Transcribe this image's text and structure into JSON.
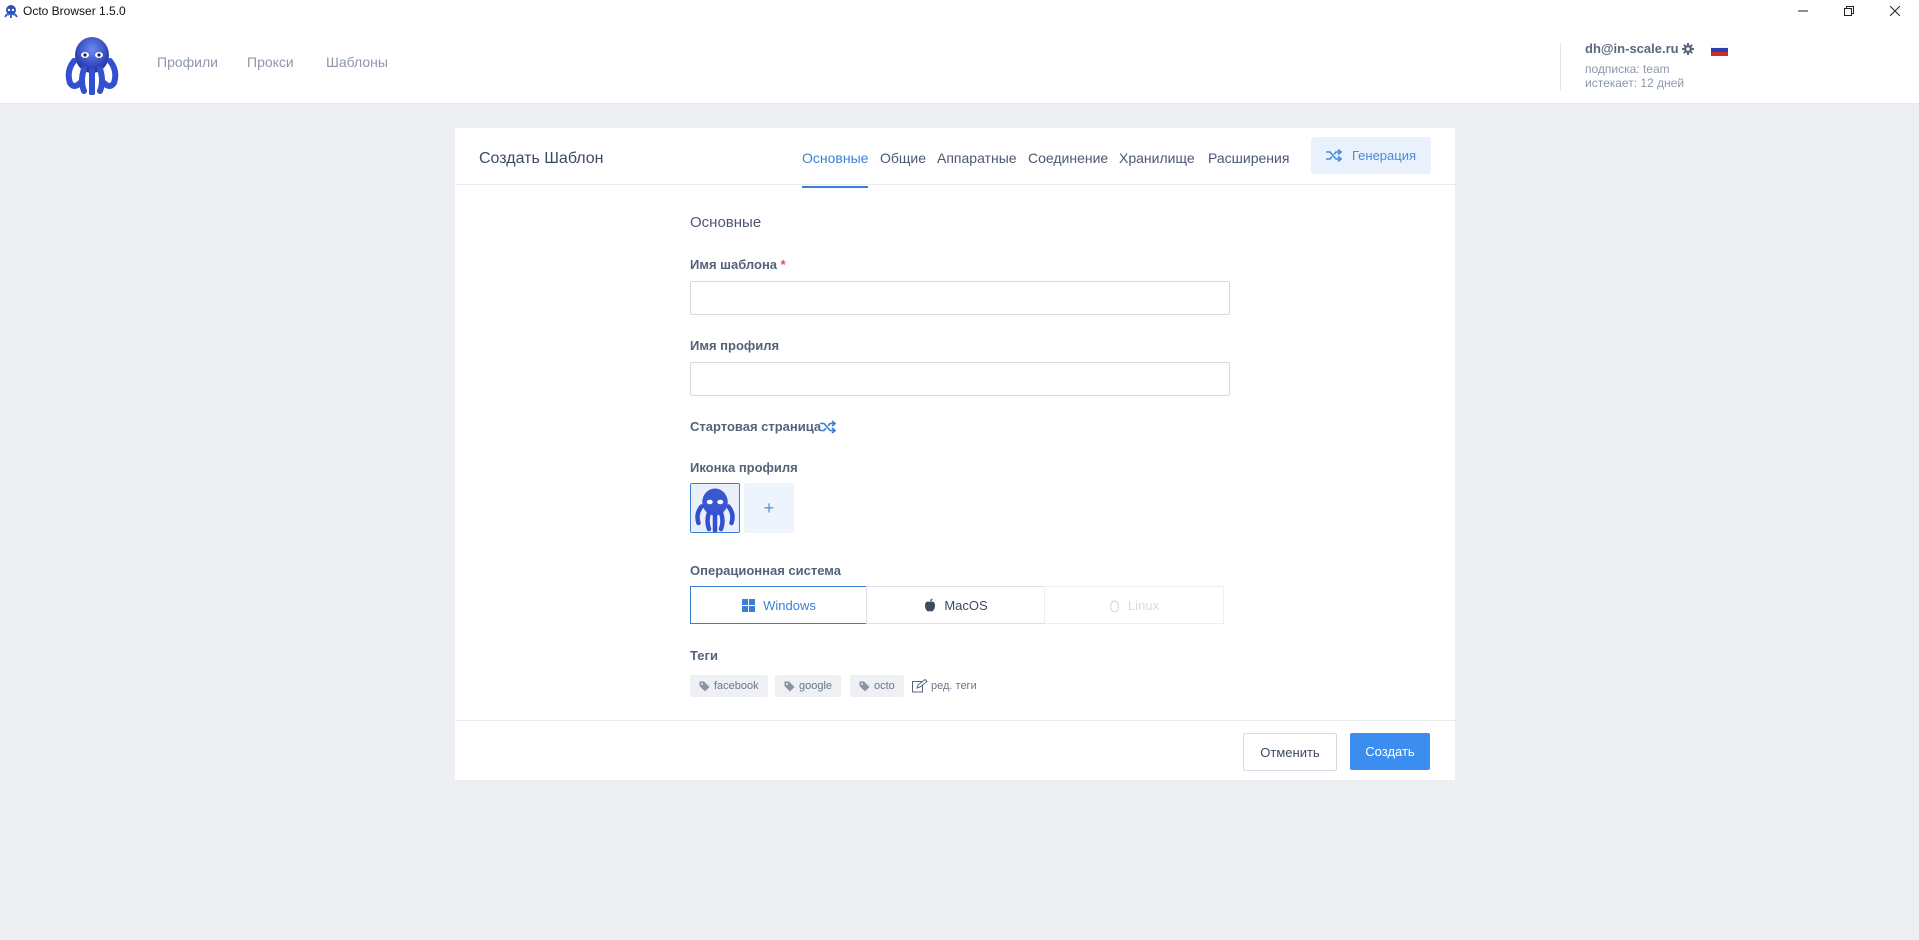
{
  "window": {
    "title": "Octo Browser 1.5.0",
    "controls": [
      "minimize",
      "restore",
      "close"
    ]
  },
  "header": {
    "nav": [
      {
        "label": "Профили"
      },
      {
        "label": "Прокси"
      },
      {
        "label": "Шаблоны"
      }
    ],
    "user": {
      "email": "dh@in-scale.ru",
      "subscription": "подписка: team",
      "expires": "истекает: 12 дней",
      "flag": "russia-flag-icon"
    }
  },
  "card": {
    "title": "Создать Шаблон",
    "tabs": [
      {
        "label": "Основные",
        "active": true
      },
      {
        "label": "Общие",
        "active": false
      },
      {
        "label": "Аппаратные",
        "active": false
      },
      {
        "label": "Соединение",
        "active": false
      },
      {
        "label": "Хранилище",
        "active": false
      },
      {
        "label": "Расширения",
        "active": false
      }
    ],
    "generate_label": "Генерация",
    "section_title": "Основные",
    "fields": {
      "template_name_label": "Имя шаблона",
      "template_name_required": "*",
      "template_name_value": "",
      "profile_name_label": "Имя профиля",
      "profile_name_value": "",
      "start_page_label": "Стартовая страница",
      "profile_icon_label": "Иконка профиля",
      "add_icon_label": "+",
      "os_label": "Операционная система",
      "os_options": [
        {
          "label": "Windows",
          "icon": "windows-icon",
          "state": "selected"
        },
        {
          "label": "MacOS",
          "icon": "apple-icon",
          "state": "normal"
        },
        {
          "label": "Linux",
          "icon": "linux-icon",
          "state": "disabled"
        }
      ],
      "tags_label": "Теги",
      "tags": [
        "facebook",
        "google",
        "octo"
      ],
      "edit_tags_label": "ред. теги"
    },
    "buttons": {
      "cancel": "Отменить",
      "create": "Создать"
    }
  },
  "colors": {
    "accent": "#3b7fd4",
    "primary_button": "#3b8ef0",
    "background": "#eeeff3",
    "required": "#e0457b"
  }
}
